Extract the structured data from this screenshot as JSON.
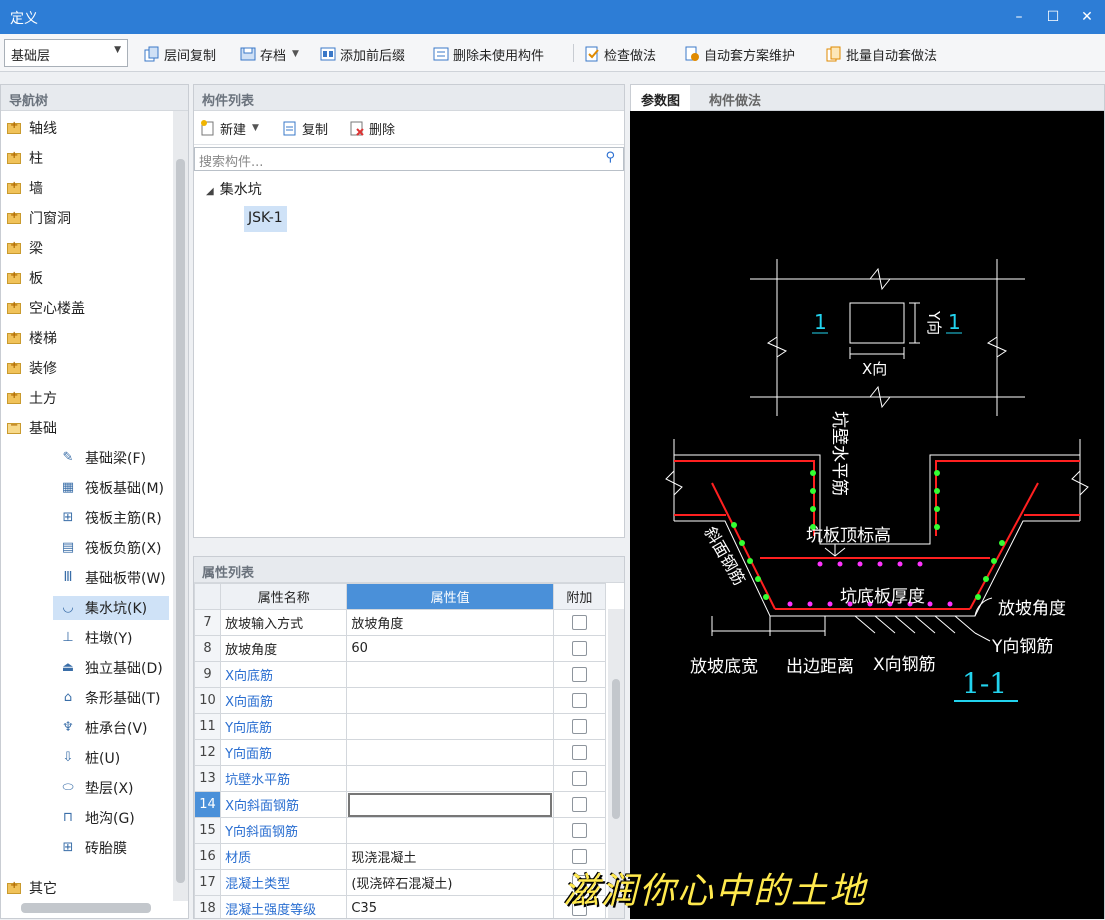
{
  "window": {
    "title": "定义",
    "min_label": "–",
    "max_label": "☐",
    "close_label": "✕"
  },
  "toolbar": {
    "layer_value": "基础层",
    "items": [
      "层间复制",
      "存档",
      "添加前后缀",
      "删除未使用构件",
      "检查做法",
      "自动套方案维护",
      "批量自动套做法"
    ]
  },
  "nav": {
    "header": "导航树",
    "folders": [
      "轴线",
      "柱",
      "墙",
      "门窗洞",
      "梁",
      "板",
      "空心楼盖",
      "楼梯",
      "装修",
      "土方",
      "基础"
    ],
    "children": [
      "基础梁(F)",
      "筏板基础(M)",
      "筏板主筋(R)",
      "筏板负筋(X)",
      "基础板带(W)",
      "集水坑(K)",
      "柱墩(Y)",
      "独立基础(D)",
      "条形基础(T)",
      "桩承台(V)",
      "桩(U)",
      "垫层(X)",
      "地沟(G)",
      "砖胎膜"
    ],
    "footer_folder": "其它",
    "selected": "集水坑(K)"
  },
  "components": {
    "header": "构件列表",
    "new_label": "新建",
    "copy_label": "复制",
    "delete_label": "删除",
    "search_placeholder": "搜索构件...",
    "tree_root": "集水坑",
    "tree_item": "JSK-1"
  },
  "properties": {
    "header": "属性列表",
    "col_name": "属性名称",
    "col_value": "属性值",
    "col_extra": "附加",
    "rows": [
      {
        "num": "7",
        "name": "放坡输入方式",
        "value": "放坡角度",
        "blue": false
      },
      {
        "num": "8",
        "name": "放坡角度",
        "value": "60",
        "blue": false
      },
      {
        "num": "9",
        "name": "X向底筋",
        "value": "",
        "blue": true
      },
      {
        "num": "10",
        "name": "X向面筋",
        "value": "",
        "blue": true
      },
      {
        "num": "11",
        "name": "Y向底筋",
        "value": "",
        "blue": true
      },
      {
        "num": "12",
        "name": "Y向面筋",
        "value": "",
        "blue": true
      },
      {
        "num": "13",
        "name": "坑壁水平筋",
        "value": "",
        "blue": true
      },
      {
        "num": "14",
        "name": "X向斜面钢筋",
        "value": "",
        "blue": true
      },
      {
        "num": "15",
        "name": "Y向斜面钢筋",
        "value": "",
        "blue": true
      },
      {
        "num": "16",
        "name": "材质",
        "value": "现浇混凝土",
        "blue": true
      },
      {
        "num": "17",
        "name": "混凝土类型",
        "value": "(现浇碎石混凝土)",
        "blue": true
      },
      {
        "num": "18",
        "name": "混凝土强度等级",
        "value": "C35",
        "blue": true
      }
    ],
    "active_row": "14"
  },
  "diagram_tabs": {
    "tab1": "参数图",
    "tab2": "构件做法"
  },
  "diagram": {
    "plan_label_left": "1",
    "plan_label_right": "1",
    "y_dir": "Y向",
    "x_dir": "X向",
    "wall_rebar": "坑壁水平筋",
    "top_elev": "坑板顶标高",
    "slope_rebar": "斜面钢筋",
    "bottom_thickness": "坑底板厚度",
    "slope_angle": "放坡角度",
    "y_rebar": "Y向钢筋",
    "slope_width": "放坡底宽",
    "edge_dist": "出边距离",
    "x_rebar": "X向钢筋",
    "section": "1-1",
    "colors": {
      "red": "#ff2020",
      "green": "#33ff33",
      "magenta": "#ff33ff",
      "cyan": "#22d3ee"
    }
  },
  "caption": "滋润你心中的土地"
}
